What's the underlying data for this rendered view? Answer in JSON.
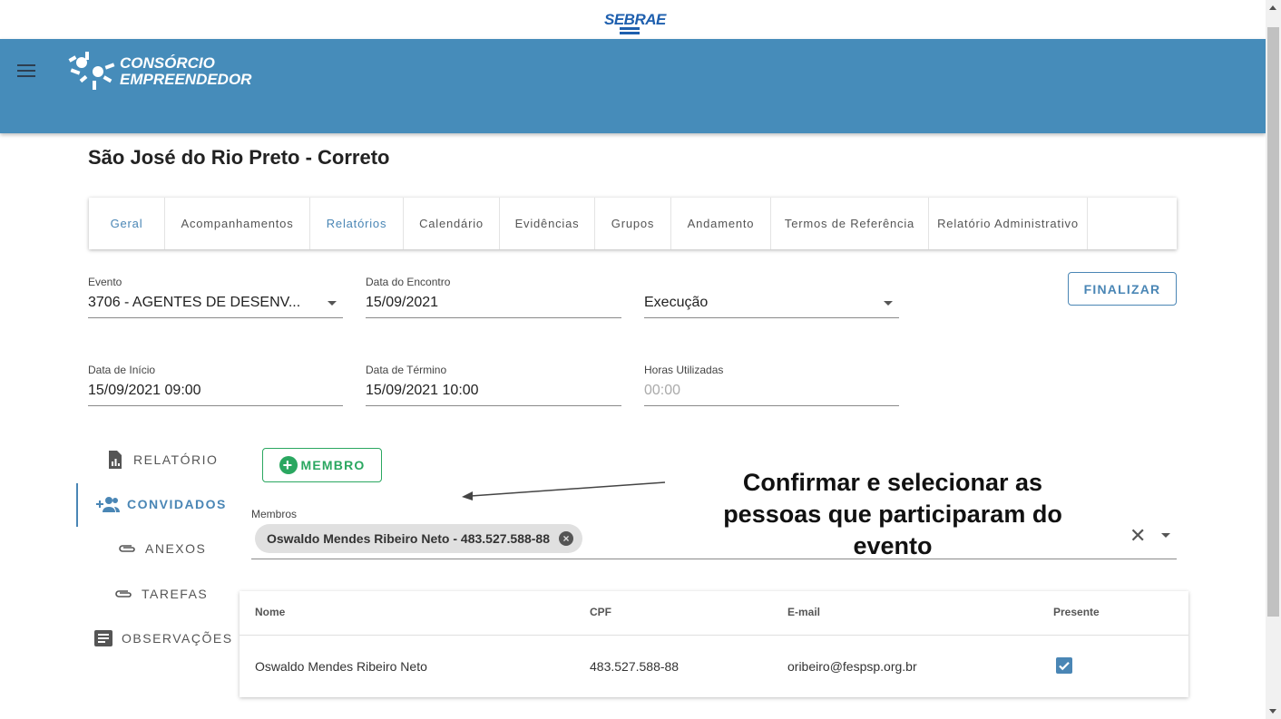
{
  "header": {
    "sebrae_logo_text": "SEBRAE",
    "app_logo_line1": "CONSÓRCIO",
    "app_logo_line2": "EMPREENDEDOR"
  },
  "page": {
    "title": "São José do Rio Preto - Correto"
  },
  "tabs": [
    {
      "label": "Geral",
      "active": true
    },
    {
      "label": "Acompanhamentos",
      "active": false
    },
    {
      "label": "Relatórios",
      "active": true
    },
    {
      "label": "Calendário",
      "active": false
    },
    {
      "label": "Evidências",
      "active": false
    },
    {
      "label": "Grupos",
      "active": false
    },
    {
      "label": "Andamento",
      "active": false
    },
    {
      "label": "Termos de Referência",
      "active": false
    },
    {
      "label": "Relatório Administrativo",
      "active": false
    }
  ],
  "form": {
    "evento": {
      "label": "Evento",
      "value": "3706 - AGENTES DE DESENV..."
    },
    "data_encontro": {
      "label": "Data do Encontro",
      "value": "15/09/2021"
    },
    "status": {
      "value": "Execução"
    },
    "data_inicio": {
      "label": "Data de Início",
      "value": "15/09/2021 09:00"
    },
    "data_termino": {
      "label": "Data de Término",
      "value": "15/09/2021 10:00"
    },
    "horas": {
      "label": "Horas Utilizadas",
      "value": "00:00"
    }
  },
  "actions": {
    "finalizar": "FINALIZAR",
    "membro": "MEMBRO"
  },
  "side_nav": [
    {
      "label": "RELATÓRIO",
      "icon": "file-chart-icon",
      "active": false
    },
    {
      "label": "CONVIDADOS",
      "icon": "add-group-icon",
      "active": true
    },
    {
      "label": "ANEXOS",
      "icon": "paperclip-icon",
      "active": false
    },
    {
      "label": "TAREFAS",
      "icon": "paperclip-icon",
      "active": false
    },
    {
      "label": "OBSERVAÇÕES",
      "icon": "notes-icon",
      "active": false
    }
  ],
  "membros": {
    "label": "Membros",
    "chips": [
      "Oswaldo Mendes Ribeiro Neto - 483.527.588-88"
    ]
  },
  "annotation": "Confirmar e selecionar as pessoas que participaram do evento",
  "table": {
    "headers": [
      "Nome",
      "CPF",
      "E-mail",
      "Presente"
    ],
    "rows": [
      {
        "nome": "Oswaldo Mendes Ribeiro Neto",
        "cpf": "483.527.588-88",
        "email": "oribeiro@fespsp.org.br",
        "presente": true
      }
    ]
  },
  "colors": {
    "primary": "#4a86b5",
    "appbar": "#468cba",
    "success": "#2aa760"
  }
}
